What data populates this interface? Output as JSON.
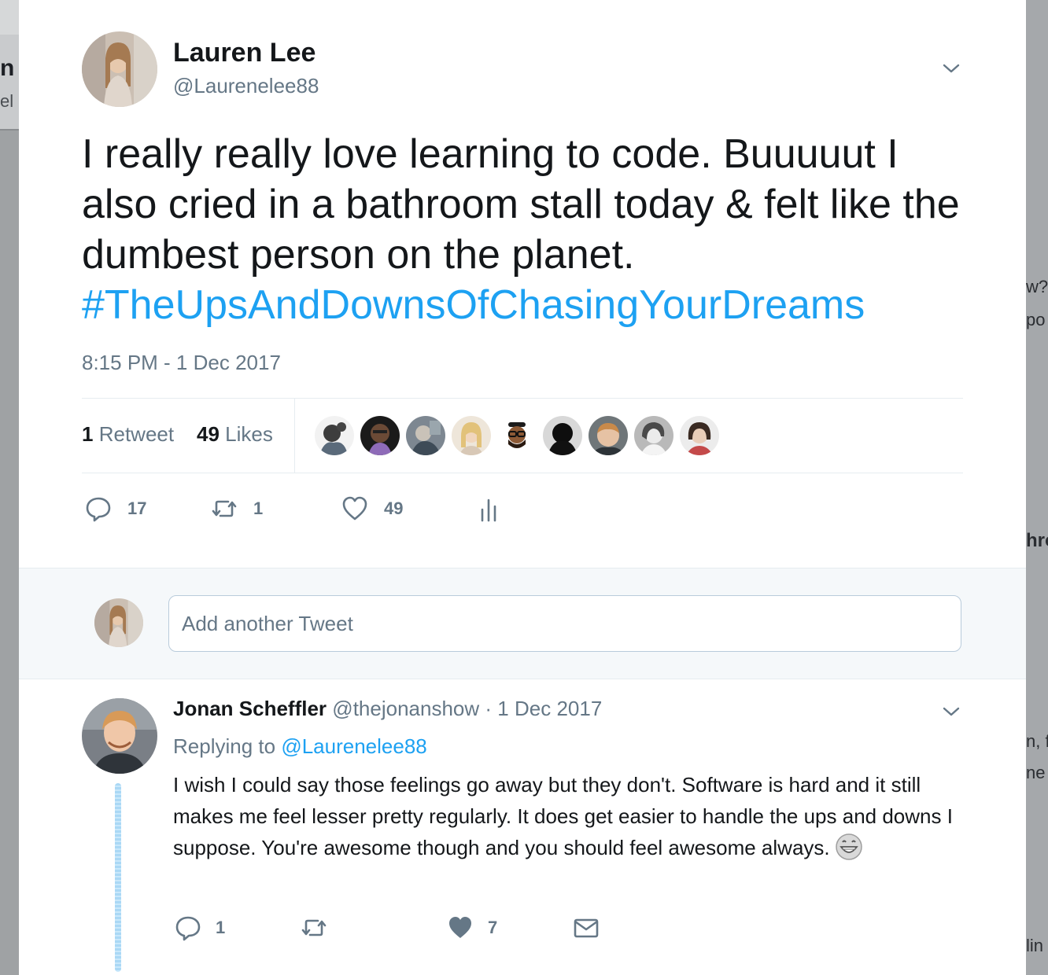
{
  "background": {
    "left_fragments": [
      "n",
      "el"
    ],
    "right_fragments": [
      "w?",
      "po",
      "hro",
      "n, f",
      "ne",
      "lin"
    ]
  },
  "tweet": {
    "author_name": "Lauren Lee",
    "author_handle": "@Laurenelee88",
    "text": "I really really love learning to code. Buuuuut I also cried in a bathroom stall today & felt like the dumbest person on the planet.",
    "hashtag": "#TheUpsAndDownsOfChasingYourDreams",
    "timestamp": "8:15 PM - 1 Dec 2017",
    "stats": {
      "retweets_count": "1",
      "retweets_label": "Retweet",
      "likes_count": "49",
      "likes_label": "Likes"
    },
    "actions": {
      "reply_count": "17",
      "retweet_count": "1",
      "like_count": "49"
    },
    "likers_count": 9
  },
  "compose": {
    "placeholder": "Add another Tweet"
  },
  "reply": {
    "author_name": "Jonan Scheffler",
    "author_handle": "@thejonanshow",
    "separator": "·",
    "date": "1 Dec 2017",
    "replying_prefix": "Replying to",
    "replying_to": "@Laurenelee88",
    "text": "I wish I could say those feelings go away but they don't. Software is hard and it still makes me feel lesser pretty regularly. It does get easier to handle the ups and downs I suppose. You're awesome though and you should feel awesome always.",
    "actions": {
      "reply_count": "1",
      "like_count": "7"
    }
  },
  "colors": {
    "link": "#1da1f2",
    "secondary_text": "#657786",
    "primary_text": "#14171a"
  }
}
